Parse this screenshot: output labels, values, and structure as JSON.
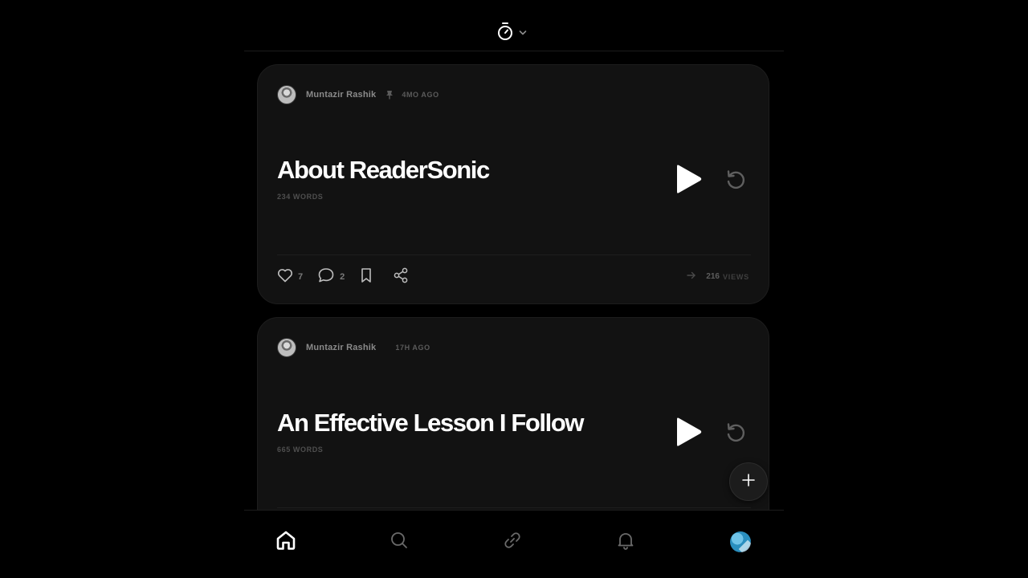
{
  "header": {
    "timer_icon": "stopwatch-icon",
    "dropdown_icon": "chevron-down-icon"
  },
  "posts": [
    {
      "author": "Muntazir Rashik",
      "pinned": true,
      "time_ago": "4MO AGO",
      "title": "About ReaderSonic",
      "word_count": "234 WORDS",
      "likes": "7",
      "comments": "2",
      "views": "216",
      "views_label": "VIEWS"
    },
    {
      "author": "Muntazir Rashik",
      "pinned": false,
      "time_ago": "17H AGO",
      "title": "An Effective Lesson I Follow",
      "word_count": "665 WORDS"
    }
  ],
  "bottom_nav": {
    "items": [
      "home-icon",
      "search-icon",
      "link-icon",
      "bell-icon",
      "profile-avatar"
    ],
    "active": "home-icon"
  },
  "colors": {
    "background": "#000000",
    "card": "#121212",
    "title": "#ffffff",
    "muted": "#5b5b5b"
  }
}
